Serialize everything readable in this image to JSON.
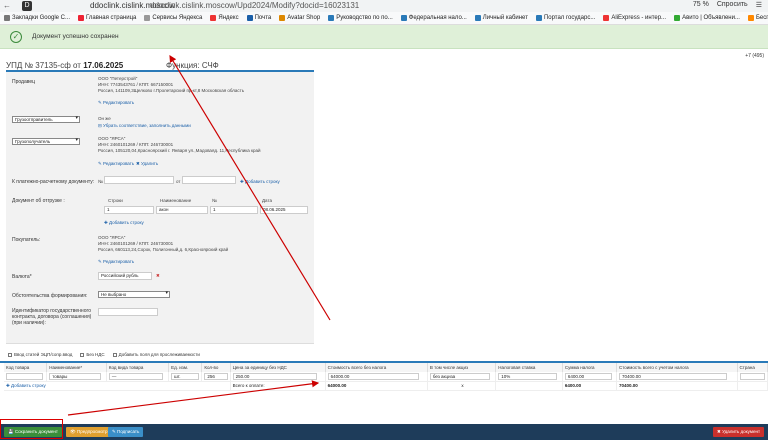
{
  "browser": {
    "url": "ddoclink.cislink.moscow/Upd2024/Modify?docid=16023131",
    "url_short": "ddoclink.cislink.moscow",
    "zoom": "75 %",
    "ask": "Спросить"
  },
  "bookmarks": [
    {
      "label": "Закладки Google C...",
      "color": "#777"
    },
    {
      "label": "Главная страница",
      "color": "#e23"
    },
    {
      "label": "Сервисы Яндекса",
      "color": "#999"
    },
    {
      "label": "Яндекс",
      "color": "#e33"
    },
    {
      "label": "Почта",
      "color": "#1a5fa8"
    },
    {
      "label": "Avatar Shop",
      "color": "#d80"
    },
    {
      "label": "Руководство по по...",
      "color": "#2a7ab8"
    },
    {
      "label": "Федеральная нало...",
      "color": "#2a7ab8"
    },
    {
      "label": "Личный кабинет",
      "color": "#2a7ab8"
    },
    {
      "label": "Портал государс...",
      "color": "#2a7ab8"
    },
    {
      "label": "AliExpress - интер...",
      "color": "#e33"
    },
    {
      "label": "Авито | Объявлени...",
      "color": "#3a3"
    },
    {
      "label": "Бесплатные векто...",
      "color": "#f80"
    }
  ],
  "notification": {
    "message": "Документ успешно сохранен"
  },
  "phone": "+7 (495)",
  "doc": {
    "title": "УПД № 37135-сф",
    "date_prefix": "от",
    "date": "17.06.2025",
    "function": "Функция: СЧФ"
  },
  "seller": {
    "label": "Продавец",
    "name": "ООО \"Петерстрой\"",
    "inn": "ИНН: 7743543761 / КПП: 667150001",
    "address": "Россия, 141109,3Щелково г.Пролетарский пр-кт,8 Московская область",
    "edit": "Редактировать"
  },
  "shipper": {
    "select": "Грузоотправитель",
    "value": "Он же",
    "link": "Убрать соответствие, заполнить данными"
  },
  "consignee": {
    "select": "Грузополучатель",
    "name": "ООО \"ЯРСА\"",
    "inn": "ИНН: 2460101269 / КПП: 246730001",
    "address": "Россия, 105120,04,Красноярский г. Января ул.,Мадоваяд. 11,Республика край",
    "edit": "Редактировать",
    "delete": "Удалить"
  },
  "payment_doc": {
    "label": "К платежно-расчетному документу:",
    "num_prefix": "№",
    "date_prefix": "от",
    "add": "Добавить строку"
  },
  "shipping_doc": {
    "label": "Документ об отгрузке :",
    "headers": [
      "Строки",
      "Наименование",
      "№",
      "Дата"
    ],
    "row": [
      "1",
      "акон",
      "1",
      "08.06.2025"
    ],
    "add": "Добавить строку"
  },
  "buyer": {
    "label": "Покупатель:",
    "name": "ООО \"ЯРСА\"",
    "inn": "ИНН: 2460101269 / КПП: 246730001",
    "address": "Россия, 660113,24,Сорок, Полигонный,д. 6,Красноярский край",
    "edit": "Редактировать"
  },
  "currency": {
    "label": "Валюта*",
    "value": "Российский рубль"
  },
  "obligation": {
    "label": "Обстоятельства формирования:",
    "value": "Не выбрано"
  },
  "gov_id": {
    "label": "Идентификатор государственного контракта, договора (соглашения) (при наличии):"
  },
  "options": [
    "Ввод статей ЭЦП/сопр.ввод",
    "Без НДС",
    "Добавить поля для прослеживаемости"
  ],
  "table": {
    "headers": [
      "Код товара",
      "Наименование*",
      "Код вида товара",
      "Ед. изм.",
      "Кол-во",
      "Цена за единицу без НДС",
      "Стоимость всего без налога",
      "В том числе акциз",
      "Налоговая ставка",
      "Сумма налога",
      "Стоимость всего с учетом налога",
      "Страна"
    ],
    "row": [
      "",
      "товары",
      "—",
      "шт.",
      "256",
      "250.00",
      "64000.00",
      "без акциза",
      "10%",
      "6400.00",
      "70400.00",
      ""
    ],
    "total_label": "Всего к оплате:",
    "totals": [
      "64000.00",
      "х",
      "6400.00",
      "70400.00"
    ],
    "add": "Добавить строку"
  },
  "footer": {
    "save": "Сохранить документ",
    "preview": "Предпросмотр",
    "sign": "Подписать",
    "delete": "Удалить документ"
  }
}
